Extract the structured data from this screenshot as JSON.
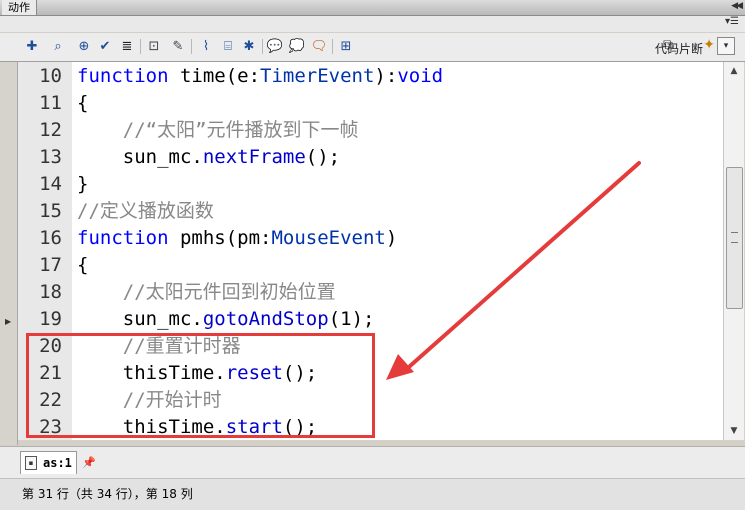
{
  "panel": {
    "title": "动作",
    "collapse_icon": "double-chevron-left-icon",
    "menu_icon": "panel-menu-icon"
  },
  "toolbar": {
    "icons": [
      "add-statement-icon",
      "find-icon",
      "target-path-icon",
      "check-syntax-icon",
      "auto-format-icon",
      "code-hint-icon",
      "debug-options-icon",
      "collapse-between-braces-icon",
      "collapse-selection-icon",
      "expand-all-icon",
      "apply-block-comment-icon",
      "apply-line-comment-icon",
      "remove-comment-icon",
      "show-hide-toolbox-icon"
    ],
    "snippet_label": "代码片断",
    "snippet_icon": "code-snippet-icon",
    "assist_icon": "script-assist-wand-icon"
  },
  "code_lines": [
    {
      "no": "10",
      "parts": [
        {
          "t": "function",
          "c": "kw"
        },
        {
          "t": " time(e:",
          "c": "plain"
        },
        {
          "t": "TimerEvent",
          "c": "ty"
        },
        {
          "t": "):",
          "c": "plain"
        },
        {
          "t": "void",
          "c": "kw"
        }
      ]
    },
    {
      "no": "11",
      "parts": [
        {
          "t": "{",
          "c": "plain"
        }
      ]
    },
    {
      "no": "12",
      "parts": [
        {
          "t": "    //“太阳”元件播放到下一帧",
          "c": "cm"
        }
      ]
    },
    {
      "no": "13",
      "parts": [
        {
          "t": "    sun_mc.",
          "c": "plain"
        },
        {
          "t": "nextFrame",
          "c": "fn"
        },
        {
          "t": "();",
          "c": "plain"
        }
      ]
    },
    {
      "no": "14",
      "parts": [
        {
          "t": "}",
          "c": "plain"
        }
      ]
    },
    {
      "no": "15",
      "parts": [
        {
          "t": "//定义播放函数",
          "c": "cm"
        }
      ]
    },
    {
      "no": "16",
      "parts": [
        {
          "t": "function",
          "c": "kw"
        },
        {
          "t": " pmhs(pm:",
          "c": "plain"
        },
        {
          "t": "MouseEvent",
          "c": "ty"
        },
        {
          "t": ")",
          "c": "plain"
        }
      ]
    },
    {
      "no": "17",
      "parts": [
        {
          "t": "{",
          "c": "plain"
        }
      ]
    },
    {
      "no": "18",
      "parts": [
        {
          "t": "    //太阳元件回到初始位置",
          "c": "cm"
        }
      ]
    },
    {
      "no": "19",
      "parts": [
        {
          "t": "    sun_mc.",
          "c": "plain"
        },
        {
          "t": "gotoAndStop",
          "c": "fn"
        },
        {
          "t": "(1);",
          "c": "plain"
        }
      ]
    },
    {
      "no": "20",
      "parts": [
        {
          "t": "    //重置计时器",
          "c": "cm"
        }
      ]
    },
    {
      "no": "21",
      "parts": [
        {
          "t": "    thisTime.",
          "c": "plain"
        },
        {
          "t": "reset",
          "c": "fn"
        },
        {
          "t": "();",
          "c": "plain"
        }
      ]
    },
    {
      "no": "22",
      "parts": [
        {
          "t": "    //开始计时",
          "c": "cm"
        }
      ]
    },
    {
      "no": "23",
      "parts": [
        {
          "t": "    thisTime.",
          "c": "plain"
        },
        {
          "t": "start",
          "c": "fn"
        },
        {
          "t": "();",
          "c": "plain"
        }
      ]
    }
  ],
  "file_tab": {
    "label": "as:1",
    "icon": "script-file-icon",
    "pin_icon": "pin-script-icon"
  },
  "status": {
    "text": "第 31 行（共 34 行），第 18 列"
  },
  "annotation": {
    "color": "#e53b3b"
  }
}
